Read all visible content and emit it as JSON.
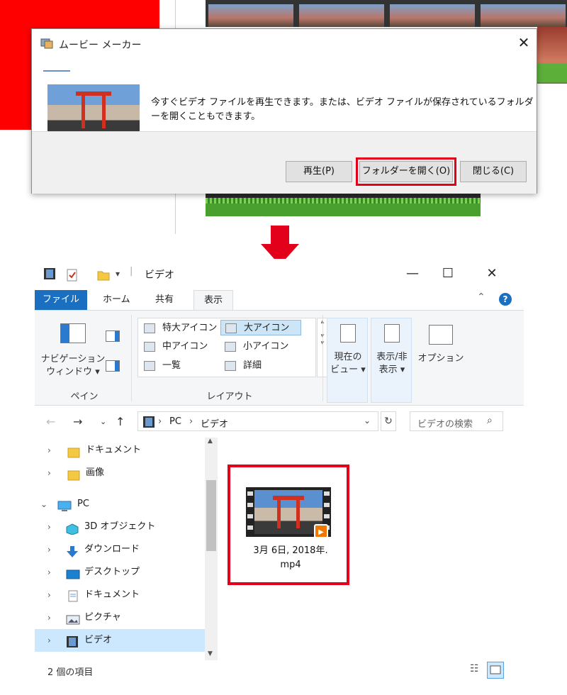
{
  "dialog": {
    "title": "ムービー メーカー",
    "close": "✕",
    "message": "今すぐビデオ ファイルを再生できます。または、ビデオ ファイルが保存されているフォルダーを開くこともできます。",
    "buttons": {
      "play": "再生(P)",
      "open_folder": "フォルダーを開く(O)",
      "close": "閉じる(C)"
    }
  },
  "explorer": {
    "title": "ビデオ",
    "window": {
      "minimize": "—",
      "maximize": "☐",
      "close": "✕"
    },
    "tabs": {
      "file": "ファイル",
      "home": "ホーム",
      "share": "共有",
      "view": "表示"
    },
    "help": "?",
    "ribbon": {
      "nav_pane": "ナビゲーション\nウィンドウ ▾",
      "group_pane": "ペイン",
      "layout_items": {
        "xl": "特大アイコン",
        "large": "大アイコン",
        "medium": "中アイコン",
        "small": "小アイコン",
        "list": "一覧",
        "details": "詳細"
      },
      "group_layout": "レイアウト",
      "current_view": "現在の\nビュー ▾",
      "show_hide": "表示/非\n表示 ▾",
      "options": "オプション"
    },
    "address": {
      "pc": "PC",
      "sep": "›",
      "folder": "ビデオ"
    },
    "search_placeholder": "ビデオの検索",
    "tree": {
      "documents_quick": "ドキュメント",
      "pictures_quick": "画像",
      "pc": "PC",
      "objects3d": "3D オブジェクト",
      "downloads": "ダウンロード",
      "desktop": "デスクトップ",
      "documents": "ドキュメント",
      "pictures": "ピクチャ",
      "videos": "ビデオ"
    },
    "file": {
      "name": "3月 6日, 2018年.\nmp4"
    },
    "status": "2 個の項目"
  },
  "colors": {
    "highlight": "#e3001b",
    "file_tab": "#1a6fc0",
    "selected": "#cce8ff",
    "arrow": "#e3001b"
  }
}
